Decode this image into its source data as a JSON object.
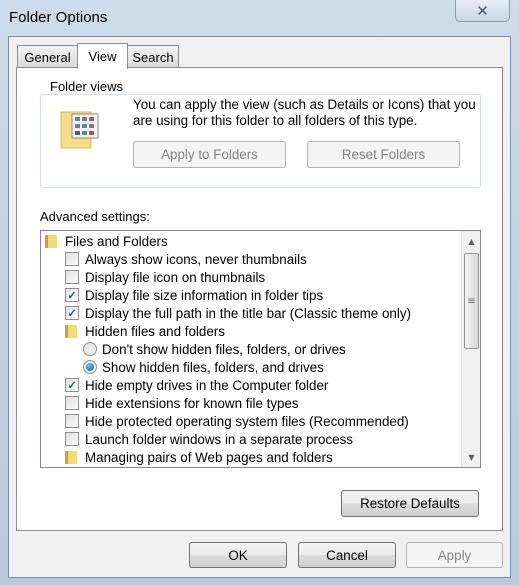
{
  "window": {
    "title": "Folder Options",
    "close_icon": "close-icon"
  },
  "tabs": [
    {
      "label": "General"
    },
    {
      "label": "View",
      "active": true
    },
    {
      "label": "Search"
    }
  ],
  "folder_views": {
    "label": "Folder views",
    "description": "You can apply the view (such as Details or Icons) that you are using for this folder to all folders of this type.",
    "apply_button": "Apply to Folders",
    "reset_button": "Reset Folders"
  },
  "advanced": {
    "label": "Advanced settings:",
    "items": [
      {
        "type": "folder",
        "label": "Files and Folders",
        "level": 0
      },
      {
        "type": "checkbox",
        "label": "Always show icons, never thumbnails",
        "checked": false,
        "level": 1
      },
      {
        "type": "checkbox",
        "label": "Display file icon on thumbnails",
        "checked": false,
        "level": 1
      },
      {
        "type": "checkbox",
        "label": "Display file size information in folder tips",
        "checked": true,
        "level": 1
      },
      {
        "type": "checkbox",
        "label": "Display the full path in the title bar (Classic theme only)",
        "checked": true,
        "level": 1
      },
      {
        "type": "folder",
        "label": "Hidden files and folders",
        "level": 1
      },
      {
        "type": "radio",
        "label": "Don't show hidden files, folders, or drives",
        "checked": false,
        "level": 2
      },
      {
        "type": "radio",
        "label": "Show hidden files, folders, and drives",
        "checked": true,
        "level": 2
      },
      {
        "type": "checkbox",
        "label": "Hide empty drives in the Computer folder",
        "checked": true,
        "level": 1
      },
      {
        "type": "checkbox",
        "label": "Hide extensions for known file types",
        "checked": false,
        "level": 1
      },
      {
        "type": "checkbox",
        "label": "Hide protected operating system files (Recommended)",
        "checked": false,
        "level": 1
      },
      {
        "type": "checkbox",
        "label": "Launch folder windows in a separate process",
        "checked": false,
        "level": 1
      },
      {
        "type": "folder",
        "label": "Managing pairs of Web pages and folders",
        "level": 1
      }
    ],
    "restore_button": "Restore Defaults"
  },
  "footer": {
    "ok": "OK",
    "cancel": "Cancel",
    "apply": "Apply"
  }
}
